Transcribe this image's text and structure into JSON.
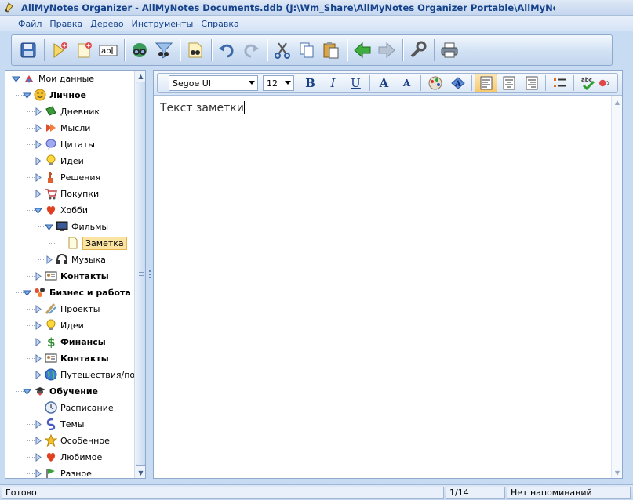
{
  "window": {
    "title": "AllMyNotes Organizer - AllMyNotes Documents.ddb (J:\\Wm_Share\\AllMyNotes Organizer Portable\\AllMyNotes Documen"
  },
  "menu": [
    "Файл",
    "Правка",
    "Дерево",
    "Инструменты",
    "Справка"
  ],
  "toolbar": [
    "save-icon",
    "new-folder-icon",
    "new-note-icon",
    "rename-icon",
    "find-icon",
    "filter-icon",
    "find-in-note-icon",
    "undo-icon",
    "redo-icon",
    "cut-icon",
    "copy-icon",
    "paste-icon",
    "back-icon",
    "forward-icon",
    "tools-icon",
    "print-icon"
  ],
  "format": {
    "font": "Segoe UI",
    "size": "12",
    "bold": "B",
    "italic": "I",
    "underline": "U",
    "grow": "A",
    "shrink": "A"
  },
  "tree": {
    "items": [
      {
        "label": "Мои данные"
      },
      {
        "label": "Личное"
      },
      {
        "label": "Дневник"
      },
      {
        "label": "Мысли"
      },
      {
        "label": "Цитаты"
      },
      {
        "label": "Идеи"
      },
      {
        "label": "Решения"
      },
      {
        "label": "Покупки"
      },
      {
        "label": "Хобби"
      },
      {
        "label": "Фильмы"
      },
      {
        "label": "Заметка"
      },
      {
        "label": "Музыка"
      },
      {
        "label": "Контакты"
      },
      {
        "label": "Бизнес и работа"
      },
      {
        "label": "Проекты"
      },
      {
        "label": "Идеи"
      },
      {
        "label": "Финансы"
      },
      {
        "label": "Контакты"
      },
      {
        "label": "Путешествия/пое"
      },
      {
        "label": "Обучение"
      },
      {
        "label": "Расписание"
      },
      {
        "label": "Темы"
      },
      {
        "label": "Особенное"
      },
      {
        "label": "Любимое"
      },
      {
        "label": "Разное"
      }
    ]
  },
  "editor": {
    "text": "Текст заметки"
  },
  "status": {
    "left": "Готово",
    "page": "1/14",
    "reminder": "Нет напоминаний"
  },
  "colors": {
    "accent": "#15428b",
    "frame": "#c7dcf2",
    "selection": "#fbe3a2"
  }
}
